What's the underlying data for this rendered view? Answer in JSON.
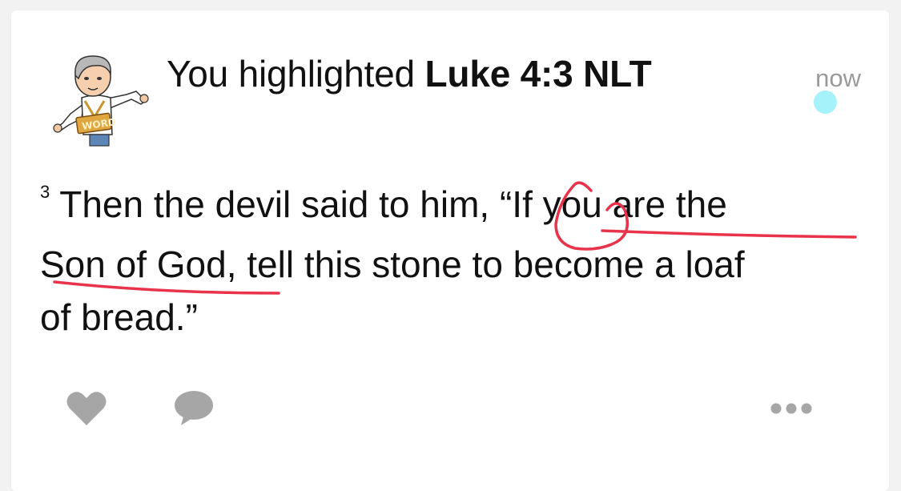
{
  "activity": {
    "prefix": "You highlighted ",
    "reference": "Luke 4:3 NLT",
    "timestamp": "now",
    "unread": true
  },
  "verse": {
    "number": "3",
    "lines": [
      "Then the devil said to him, “If you are the",
      "Son of God, tell this stone to become a loaf",
      "of bread.”"
    ]
  },
  "annotation": {
    "ink_color": "#e8334a"
  },
  "actions": {
    "like_icon": "heart-icon",
    "comment_icon": "comment-bubble-icon",
    "more_icon": "ellipsis-icon",
    "icon_color": "#a6a6a6"
  },
  "colors": {
    "unread_dot": "#a6f2fa",
    "timestamp": "#9a9a9a"
  }
}
